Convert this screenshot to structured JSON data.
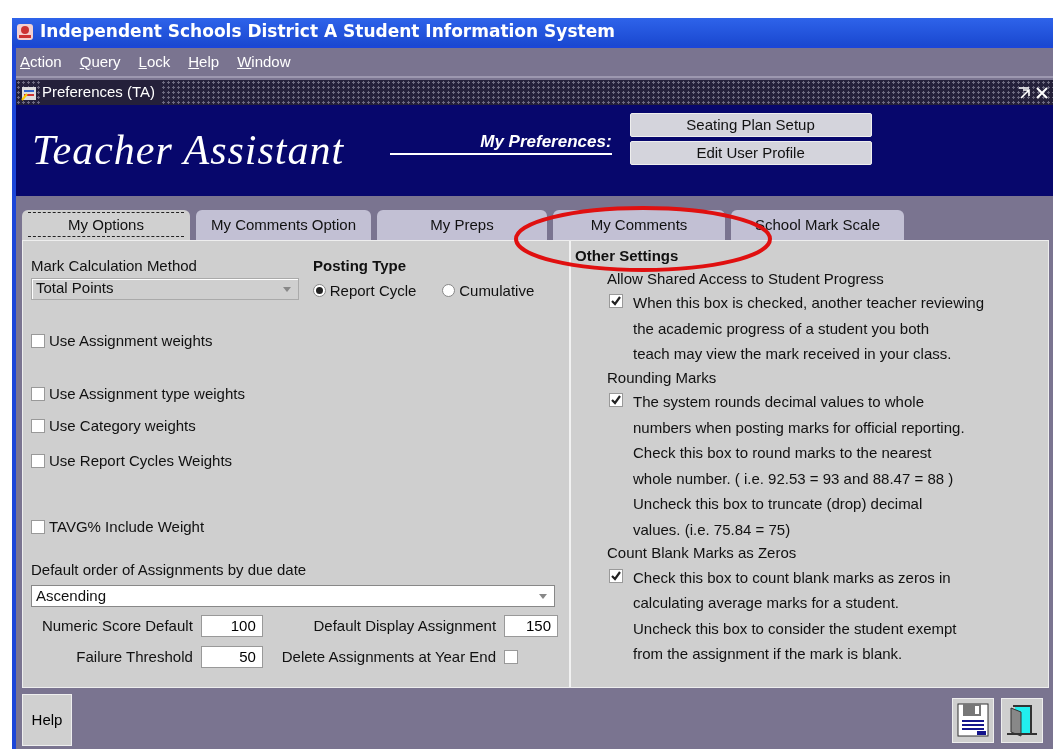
{
  "window": {
    "title": "Independent Schools District A Student Information System"
  },
  "menu": [
    {
      "label": "Action"
    },
    {
      "label": "Query"
    },
    {
      "label": "Lock"
    },
    {
      "label": "Help"
    },
    {
      "label": "Window"
    }
  ],
  "subwindow": {
    "title": "Preferences (TA)"
  },
  "header": {
    "app_title": "Teacher Assistant",
    "preferences_label": "My Preferences:",
    "buttons": [
      "Seating Plan Setup",
      "Edit User Profile"
    ]
  },
  "tabs": [
    {
      "label": "My Options",
      "selected": true
    },
    {
      "label": "My Comments Option",
      "selected": false
    },
    {
      "label": "My Preps",
      "selected": false
    },
    {
      "label": "My Comments",
      "selected": false
    },
    {
      "label": "School Mark Scale",
      "selected": false
    }
  ],
  "options": {
    "mark_calculation": {
      "label": "Mark Calculation Method",
      "value": "Total Points",
      "disabled": true
    },
    "posting_type": {
      "title": "Posting Type",
      "choices": [
        {
          "label": "Report Cycle",
          "selected": true
        },
        {
          "label": "Cumulative",
          "selected": false
        }
      ]
    },
    "checkboxes": [
      {
        "label": "Use Assignment weights",
        "checked": false
      },
      {
        "label": "Use Assignment type weights",
        "checked": false
      },
      {
        "label": "Use Category weights",
        "checked": false
      },
      {
        "label": "Use Report Cycles Weights",
        "checked": false
      },
      {
        "label": "TAVG% Include Weight",
        "checked": false
      }
    ],
    "sort_order": {
      "label": "Default order of Assignments by due date",
      "value": "Ascending",
      "disabled": false
    },
    "numeric_score_default": {
      "label": "Numeric Score Default",
      "value": "100"
    },
    "failure_threshold": {
      "label": "Failure Threshold",
      "value": "50"
    },
    "default_display_assignment": {
      "label": "Default Display Assignment",
      "value": "150"
    },
    "delete_at_year_end": {
      "label": "Delete Assignments at Year End",
      "checked": false
    }
  },
  "other_settings": {
    "title": "Other Settings",
    "sections": [
      {
        "heading": "Allow Shared Access to Student Progress",
        "checked": true,
        "lines": [
          "When this box is checked, another teacher reviewing",
          "the academic progress of a student you both",
          "teach may view the mark received in your class."
        ]
      },
      {
        "heading": "Rounding Marks",
        "checked": true,
        "lines": [
          "The system rounds decimal values to whole",
          "numbers when posting marks for official reporting.",
          "Check this box to round marks to the nearest",
          "whole number.  ( i.e.  92.53 = 93  and 88.47 = 88 )",
          "Uncheck this box to truncate (drop) decimal",
          "values.  (i.e. 75.84 = 75)"
        ]
      },
      {
        "heading": "Count Blank Marks as Zeros",
        "checked": true,
        "lines": [
          "Check this box to count blank marks as zeros in",
          "calculating average marks for a student.",
          "Uncheck this box to consider the student exempt",
          "from the assignment if the mark is blank."
        ]
      }
    ]
  },
  "footer": {
    "help_button": "Help"
  }
}
